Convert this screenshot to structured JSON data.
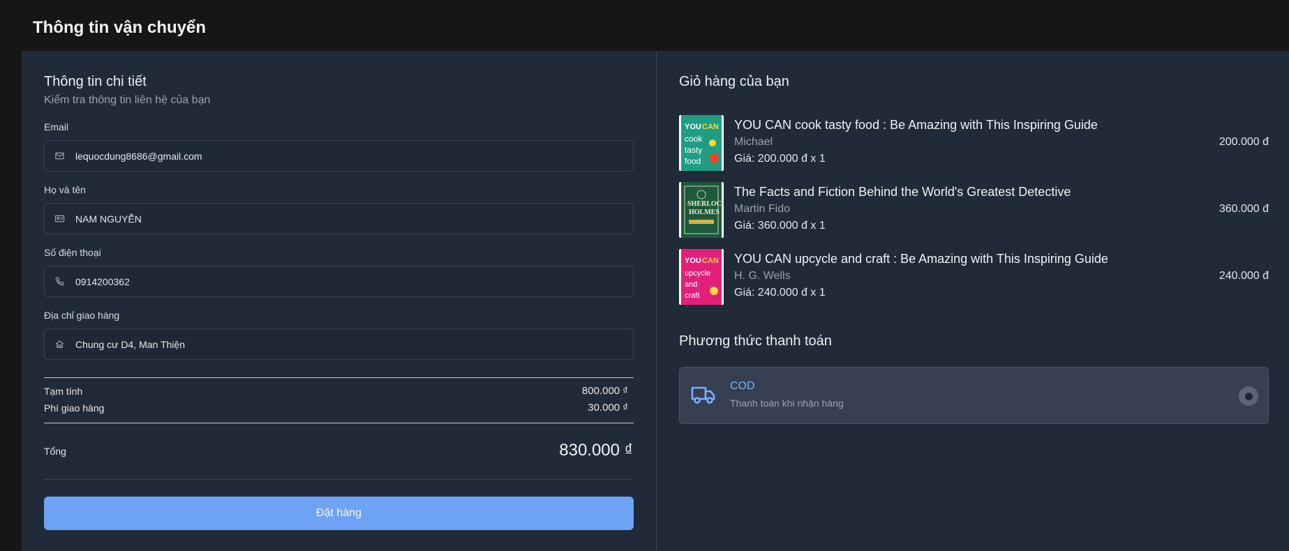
{
  "header": {
    "title": "Thông tin vận chuyển"
  },
  "details": {
    "heading": "Thông tin chi tiết",
    "subheading": "Kiểm tra thông tin liên hệ của bạn",
    "fields": [
      {
        "label": "Email",
        "value": "lequocdung8686@gmail.com",
        "icon": "mail-icon"
      },
      {
        "label": "Họ và tên",
        "value": "NAM NGUYỄN",
        "icon": "id-card-icon"
      },
      {
        "label": "Số điện thoại",
        "value": "0914200362",
        "icon": "phone-icon"
      },
      {
        "label": "Địa chỉ giao hàng",
        "value": "Chung cư D4, Man Thiện",
        "icon": "home-icon"
      }
    ]
  },
  "summary": {
    "subtotal_label": "Tạm tính",
    "subtotal_value": "800.000 ₫",
    "shipping_label": "Phí giao hàng",
    "shipping_value": "30.000 ₫",
    "total_label": "Tổng",
    "total_value": "830.000 ₫"
  },
  "order_button": {
    "label": "Đặt hàng",
    "color": "#6ea2f4"
  },
  "cart": {
    "heading": "Giỏ hàng của bạn",
    "items": [
      {
        "title": "YOU CAN cook tasty food : Be Amazing with This Inspiring Guide",
        "author": "Michael",
        "price_line": "Giá: 200.000 đ x 1",
        "total": "200.000 đ",
        "cover_color": "#1f9e83"
      },
      {
        "title": "The Facts and Fiction Behind the World's Greatest Detective",
        "author": "Martin Fido",
        "price_line": "Giá: 360.000 đ x 1",
        "total": "360.000 đ",
        "cover_color": "#1d5a3d"
      },
      {
        "title": "YOU CAN upcycle and craft : Be Amazing with This Inspiring Guide",
        "author": "H. G. Wells",
        "price_line": "Giá: 240.000 đ x 1",
        "total": "240.000 đ",
        "cover_color": "#e21f7a"
      }
    ]
  },
  "payment": {
    "heading": "Phương thức thanh toán",
    "method_name": "COD",
    "method_desc": "Thanh toán khi nhận hàng",
    "icon": "truck-icon",
    "accent": "#7bb0ff",
    "selected": true
  }
}
